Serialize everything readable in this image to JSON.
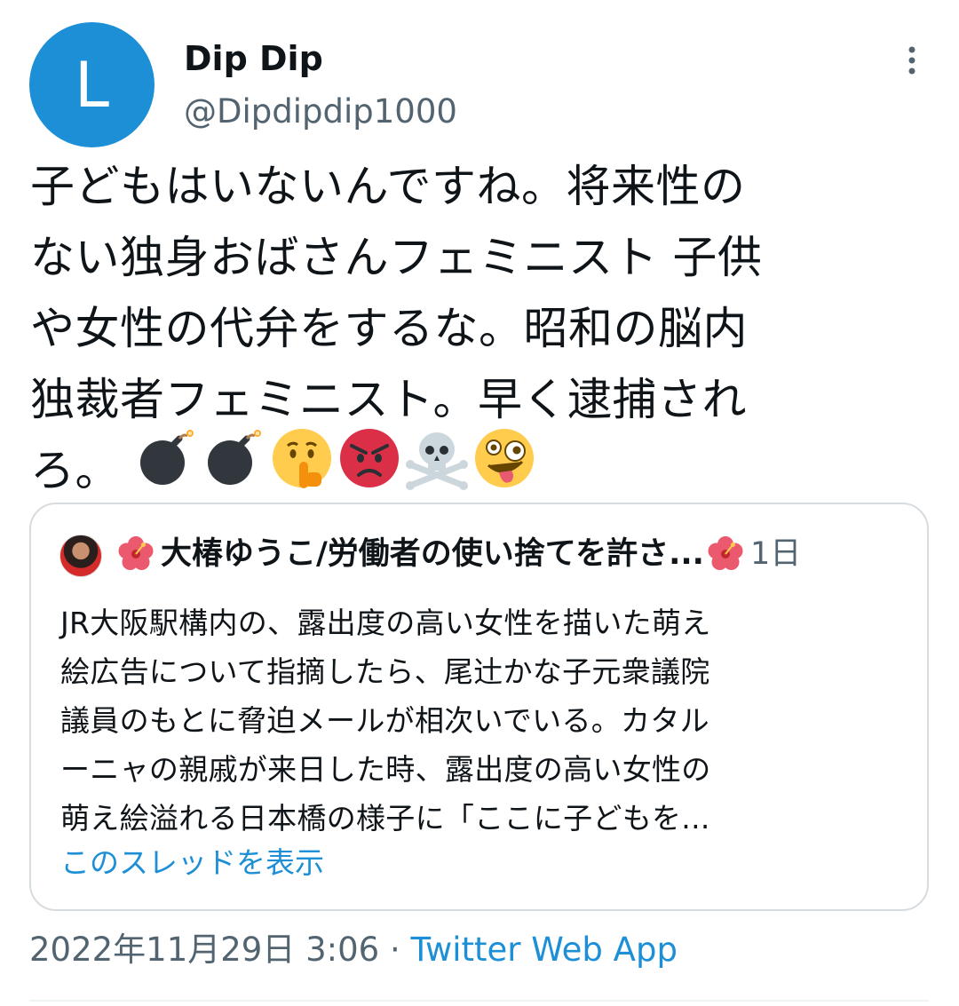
{
  "author": {
    "avatar_letter": "L",
    "avatar_color": "#1d8fd6",
    "display_name": "Dip Dip",
    "handle": "@Dipdipdip1000"
  },
  "tweet": {
    "text": "子どもはいないんですね。将来性の\nない独身おばさんフェミニスト 子供\nや女性の代弁をするな。昭和の脳内\n独裁者フェミニスト。早く逮捕され\nろ。",
    "emojis": [
      "bomb-emoji",
      "bomb-emoji",
      "shushing-face-emoji",
      "angry-face-emoji",
      "skull-and-crossbones-emoji",
      "zany-face-emoji"
    ]
  },
  "quote": {
    "author_name": "大椿ゆうこ/労働者の使い捨てを許さ...",
    "time": "1日",
    "body": "JR大阪駅構内の、露出度の高い女性を描いた萌え\n絵広告について指摘したら、尾辻かな子元衆議院\n議員のもとに脅迫メールが相次いでいる。カタル\nーニャの親戚が来日した時、露出度の高い女性の\n萌え絵溢れる日本橋の様子に「ここに子どもを...",
    "show_thread": "このスレッドを表示"
  },
  "meta": {
    "timestamp": "2022年11月29日 3:06",
    "separator": " · ",
    "source": "Twitter Web App"
  },
  "colors": {
    "accent": "#1d8fd6",
    "secondary_text": "#536471",
    "border": "#d6dce0"
  }
}
